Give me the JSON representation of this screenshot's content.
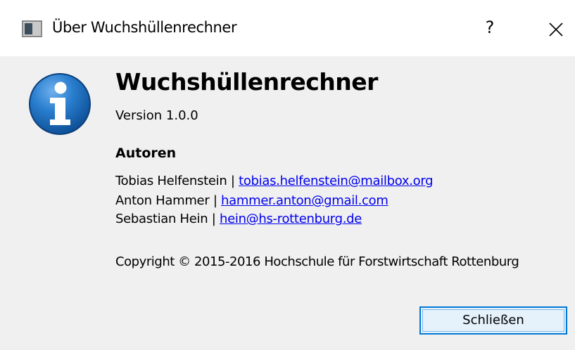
{
  "window": {
    "title": "Über Wuchshüllenrechner",
    "help_label": "?",
    "close_icon": "close-icon"
  },
  "about": {
    "app_name": "Wuchshüllenrechner",
    "version": "Version 1.0.0",
    "authors_heading": "Autoren",
    "separator": "|",
    "authors": [
      {
        "name": "Tobias Helfenstein",
        "email": "tobias.helfenstein@mailbox.org"
      },
      {
        "name": "Anton Hammer",
        "email": "hammer.anton@gmail.com"
      },
      {
        "name": "Sebastian Hein",
        "email": "hein@hs-rottenburg.de"
      }
    ],
    "copyright": "Copyright © 2015-2016 Hochschule für Forstwirtschaft Rottenburg",
    "icon": "info-icon"
  },
  "buttons": {
    "close_label": "Schließen"
  },
  "colors": {
    "link": "#0000ee",
    "button_border": "#0078d7",
    "button_bg": "#e5f1fb",
    "client_bg": "#f0f0f0",
    "info_icon_blue": "#1f6fb8"
  }
}
